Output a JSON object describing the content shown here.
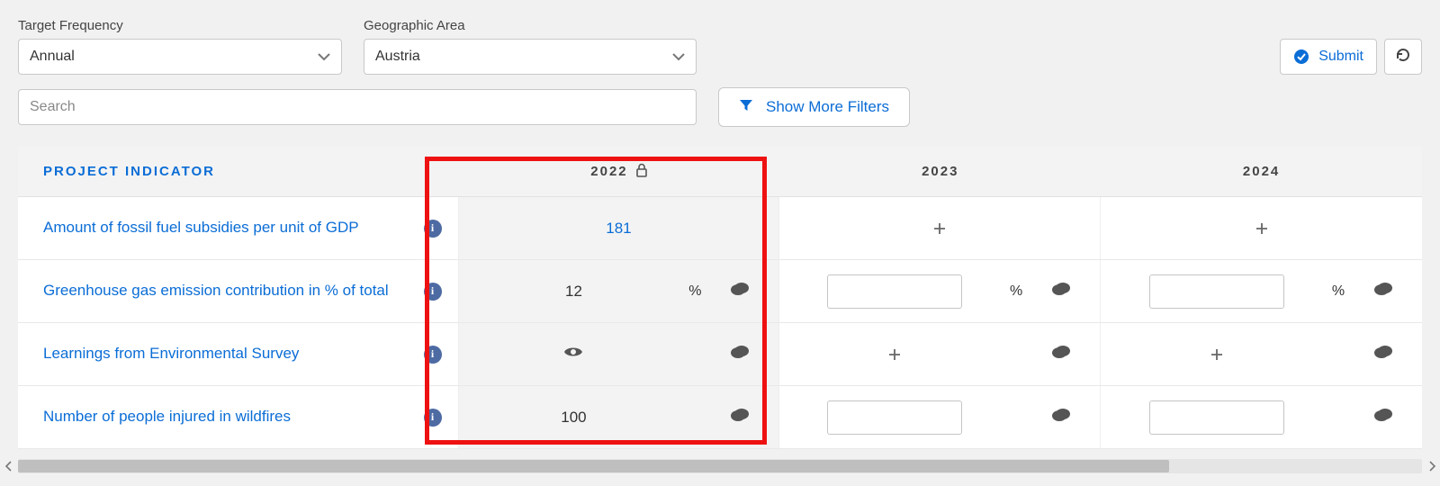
{
  "filters": {
    "frequency_label": "Target Frequency",
    "frequency_value": "Annual",
    "geo_label": "Geographic Area",
    "geo_value": "Austria",
    "search_placeholder": "Search",
    "more_filters": "Show More Filters"
  },
  "actions": {
    "submit": "Submit"
  },
  "table": {
    "header_indicator": "PROJECT INDICATOR",
    "years": [
      "2022",
      "2023",
      "2024"
    ],
    "locked_year_index": 0,
    "rows": [
      {
        "label": "Amount of fossil fuel subsidies per unit of GDP",
        "cells": [
          {
            "value": "181",
            "value_is_link": true
          },
          {
            "add": true
          },
          {
            "add": true
          }
        ]
      },
      {
        "label": "Greenhouse gas emission contribution in % of total",
        "cells": [
          {
            "value": "12",
            "unit": "%",
            "comment": true
          },
          {
            "input": true,
            "unit": "%",
            "comment": true
          },
          {
            "input": true,
            "unit": "%",
            "comment": true
          }
        ]
      },
      {
        "label": "Learnings from Environmental Survey",
        "cells": [
          {
            "eye": true,
            "comment": true
          },
          {
            "add": true,
            "comment": true
          },
          {
            "add": true,
            "comment": true
          }
        ]
      },
      {
        "label": "Number of people injured in wildfires",
        "cells": [
          {
            "value": "100",
            "comment": true
          },
          {
            "input": true,
            "comment": true
          },
          {
            "input": true,
            "comment": true
          }
        ]
      }
    ]
  }
}
